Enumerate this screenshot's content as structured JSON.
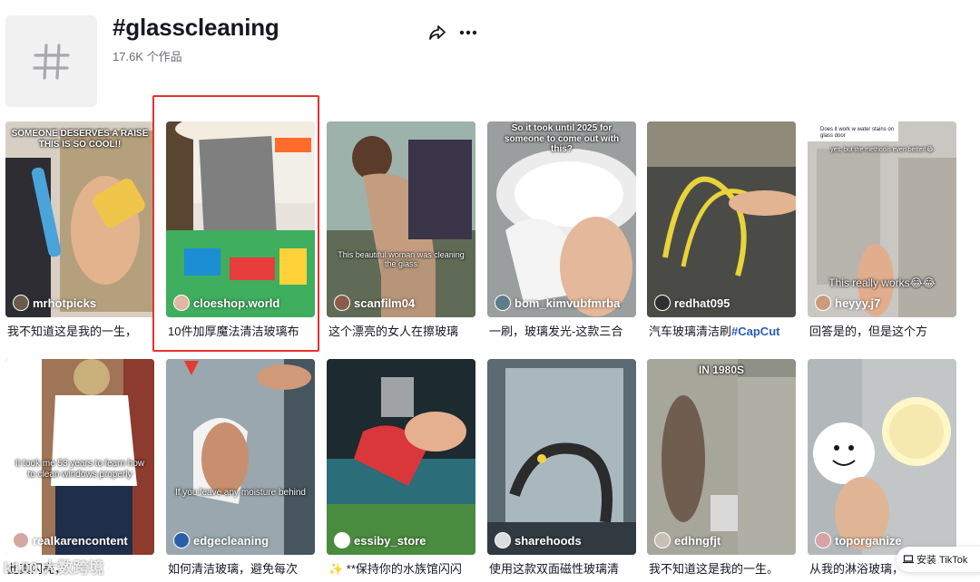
{
  "header": {
    "title": "#glasscleaning",
    "count": "17.6K 个作品",
    "tag_icon": "hashtag-icon",
    "share_icon": "share-icon",
    "more_icon": "more-icon"
  },
  "videos": [
    {
      "author": "mrhotpicks",
      "caption": "我不知道这是我的一生，",
      "overlay": "SOMEONE DESERVES A RAISE THIS IS SO COOL!!"
    },
    {
      "author": "cloeshop.world",
      "caption": "10件加厚魔法清洁玻璃布",
      "overlay": ""
    },
    {
      "author": "scanfilm04",
      "caption": "这个漂亮的女人在擦玻璃",
      "overlay": "This beautiful woman was cleaning the glass"
    },
    {
      "author": "bom_kimvubfmrba",
      "caption": "一刷，玻璃发光-这款三合",
      "overlay": "So it took until 2025 for someone to come out with this?"
    },
    {
      "author": "redhat095",
      "caption": "汽车玻璃清洁刷",
      "caption_tag": "#CapCut",
      "overlay": ""
    },
    {
      "author": "heyyy.j7",
      "caption": "回答是的，但是这个方",
      "overlay": "This really works😂😂",
      "comment_q": "Does it work w water stains on glass door",
      "comment_a": "yes, but the methodis even better!😂"
    },
    {
      "author": "realkarencontent",
      "caption": "此真闪亮，",
      "overlay": "It took me 53 years to learn how to clean windows properly"
    },
    {
      "author": "edgecleaning",
      "caption": "如何清洁玻璃，避免每次",
      "overlay": "If you leave any moisture behind"
    },
    {
      "author": "essiby_store",
      "caption": "✨ **保持你的水族馆闪闪",
      "overlay": ""
    },
    {
      "author": "sharehoods",
      "caption": "使用这款双面磁性玻璃清",
      "overlay": ""
    },
    {
      "author": "edhngfjt",
      "caption": "我不知道这是我的一生。",
      "overlay": "IN 1980S"
    },
    {
      "author": "toporganize",
      "caption": "从我的淋浴玻璃，",
      "overlay": ""
    }
  ],
  "get_app": "安装 TikTok",
  "watermark": "k100 大数跨境",
  "colors": {
    "highlight": "#e8312f",
    "tag_link": "#2b5db9"
  }
}
